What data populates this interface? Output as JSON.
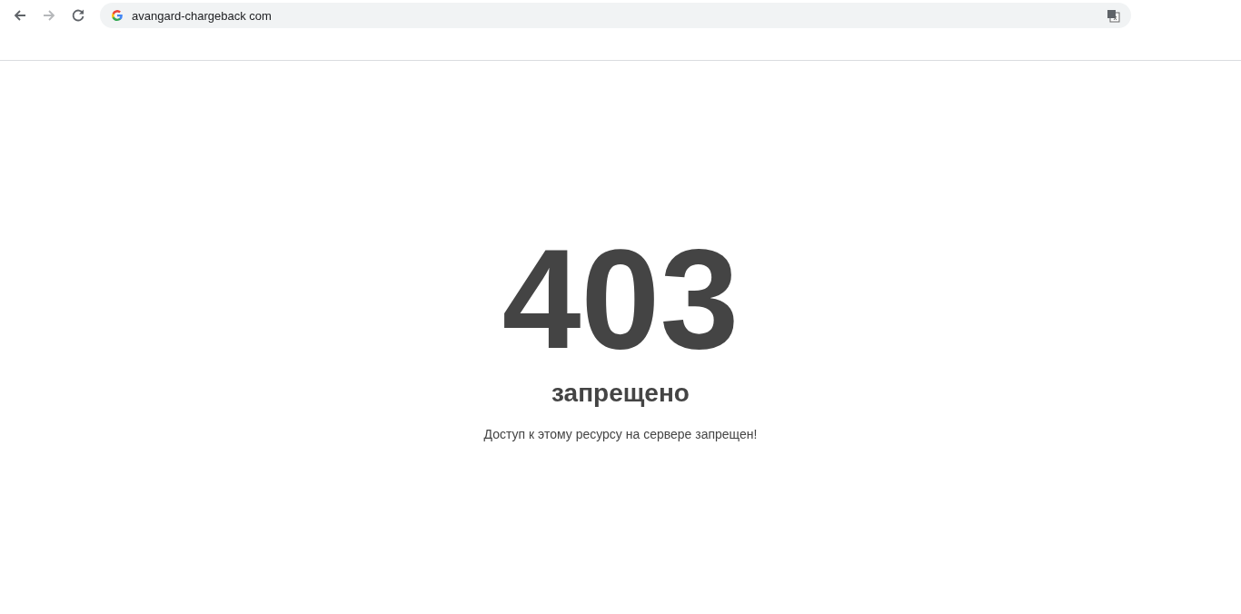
{
  "browser": {
    "nav_buttons": [
      {
        "kind": "back",
        "disabled": false
      },
      {
        "kind": "forward",
        "disabled": true
      },
      {
        "kind": "reload",
        "disabled": false
      }
    ],
    "address": "avangard-chargeback com"
  },
  "error": {
    "code": "403",
    "title": "запрещено",
    "message": "Доступ к этому ресурсу на сервере запрещен!"
  }
}
